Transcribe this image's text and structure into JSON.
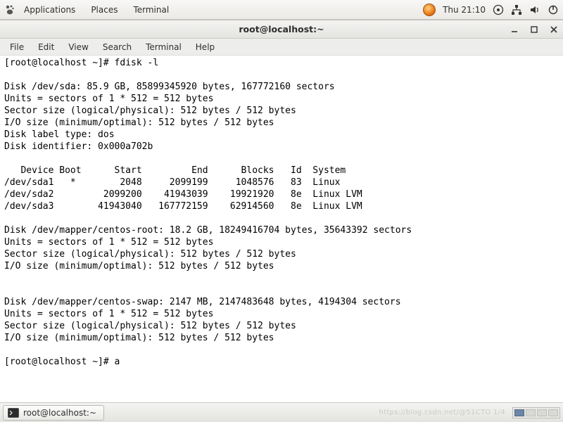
{
  "topbar": {
    "items": [
      "Applications",
      "Places",
      "Terminal"
    ],
    "clock": "Thu 21:10"
  },
  "window": {
    "title": "root@localhost:~"
  },
  "menubar": {
    "items": [
      "File",
      "Edit",
      "View",
      "Search",
      "Terminal",
      "Help"
    ]
  },
  "terminal": {
    "prompt1": "[root@localhost ~]# ",
    "cmd1": "fdisk -l",
    "disk_sda": {
      "l1": "Disk /dev/sda: 85.9 GB, 85899345920 bytes, 167772160 sectors",
      "l2": "Units = sectors of 1 * 512 = 512 bytes",
      "l3": "Sector size (logical/physical): 512 bytes / 512 bytes",
      "l4": "I/O size (minimum/optimal): 512 bytes / 512 bytes",
      "l5": "Disk label type: dos",
      "l6": "Disk identifier: 0x000a702b"
    },
    "part_header": "   Device Boot      Start         End      Blocks   Id  System",
    "part_rows": [
      "/dev/sda1   *        2048     2099199     1048576   83  Linux",
      "/dev/sda2         2099200    41943039    19921920   8e  Linux LVM",
      "/dev/sda3        41943040   167772159    62914560   8e  Linux LVM"
    ],
    "disk_root": {
      "l1": "Disk /dev/mapper/centos-root: 18.2 GB, 18249416704 bytes, 35643392 sectors",
      "l2": "Units = sectors of 1 * 512 = 512 bytes",
      "l3": "Sector size (logical/physical): 512 bytes / 512 bytes",
      "l4": "I/O size (minimum/optimal): 512 bytes / 512 bytes"
    },
    "disk_swap": {
      "l1": "Disk /dev/mapper/centos-swap: 2147 MB, 2147483648 bytes, 4194304 sectors",
      "l2": "Units = sectors of 1 * 512 = 512 bytes",
      "l3": "Sector size (logical/physical): 512 bytes / 512 bytes",
      "l4": "I/O size (minimum/optimal): 512 bytes / 512 bytes"
    },
    "prompt2": "[root@localhost ~]# ",
    "cmd2": "a"
  },
  "taskbar": {
    "app_label": "root@localhost:~",
    "watermark": "https://blog.csdn.net/@51CTO 1/4"
  }
}
